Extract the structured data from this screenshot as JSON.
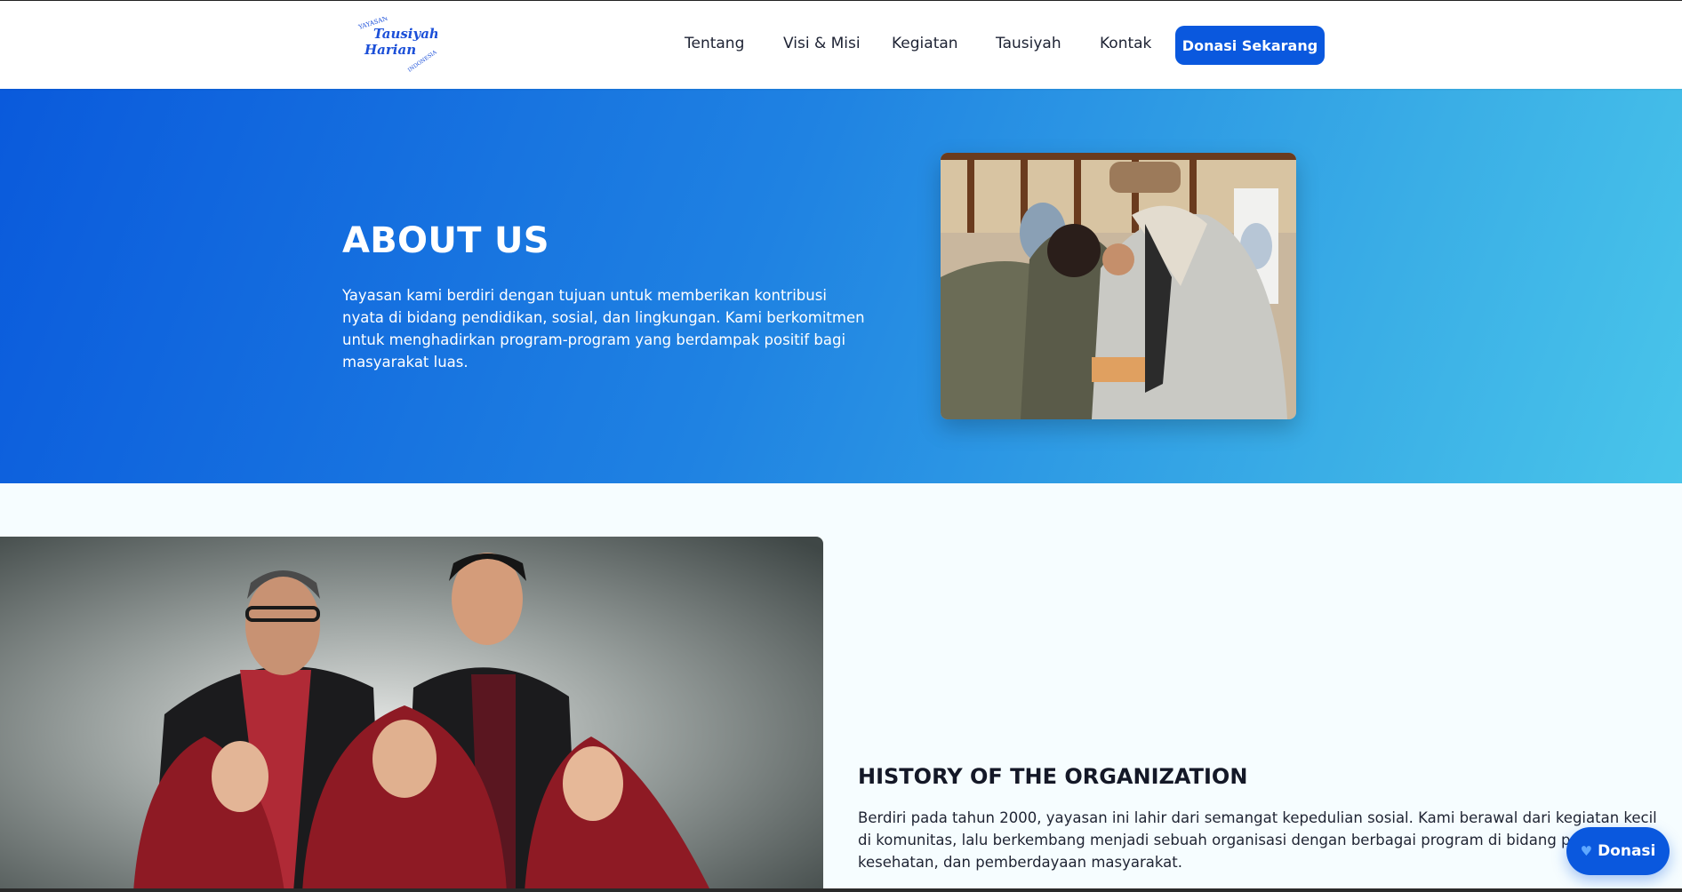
{
  "header": {
    "logo_text": [
      "YAYASAN",
      "Tausiyah",
      "Harian",
      "INDONESIA"
    ],
    "nav": [
      {
        "label": "Tentang"
      },
      {
        "label": "Visi & Misi"
      },
      {
        "label": "Kegiatan"
      },
      {
        "label": "Tausiyah"
      },
      {
        "label": "Kontak"
      }
    ],
    "donate_button": "Donasi Sekarang"
  },
  "hero": {
    "title": "ABOUT US",
    "text": "Yayasan kami berdiri dengan tujuan untuk memberikan kontribusi nyata di bidang pendidikan, sosial, dan lingkungan. Kami berkomitmen untuk menghadirkan program-program yang berdampak positif bagi masyarakat luas."
  },
  "history": {
    "title": "HISTORY OF THE ORGANIZATION",
    "text": "Berdiri pada tahun 2000, yayasan ini lahir dari semangat kepedulian sosial. Kami berawal dari kegiatan kecil di komunitas, lalu berkembang menjadi sebuah organisasi dengan berbagai program di bidang pendidikan, kesehatan, dan pemberdayaan masyarakat."
  },
  "floating_button": {
    "label": "Donasi",
    "icon": "heart-icon"
  },
  "colors": {
    "primary": "#0a58de",
    "hero_gradient_start": "#0a5adc",
    "hero_gradient_end": "#49c5ea",
    "page_background": "#f6fdff"
  }
}
